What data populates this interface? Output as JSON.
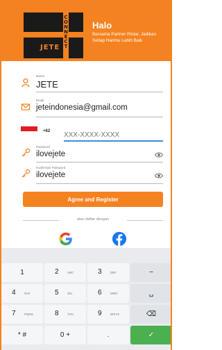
{
  "header": {
    "logo_word": "JETE",
    "logo_vertical": "CONNECT",
    "greeting_title": "Halo",
    "greeting_subtitle": "Bersama Partner Pintar, Jadikan Setiap Harimu Lebih Baik"
  },
  "form": {
    "name": {
      "label": "Name",
      "value": "JETE"
    },
    "email": {
      "label": "Email",
      "value": "jeteindonesia@gmail.com"
    },
    "phone": {
      "dial_code": "+62",
      "placeholder": "XXX-XXXX-XXXX"
    },
    "password": {
      "label": "Password",
      "value": "ilovejete"
    },
    "confirm_password": {
      "label": "Konfirmasi Password",
      "value": "ilovejete"
    },
    "register_label": "Agree and Register",
    "divider_text": "atau daftar dengan"
  },
  "social": [
    "google-icon",
    "facebook-icon"
  ],
  "keyboard": {
    "rows": [
      [
        {
          "main": "1",
          "sub": ""
        },
        {
          "main": "2",
          "sub": "ABC"
        },
        {
          "main": "3",
          "sub": "DEF"
        },
        {
          "main": "−",
          "sub": ""
        }
      ],
      [
        {
          "main": "4",
          "sub": "GHI"
        },
        {
          "main": "5",
          "sub": "JKL"
        },
        {
          "main": "6",
          "sub": "MNO"
        },
        {
          "main": "␣",
          "sub": ""
        }
      ],
      [
        {
          "main": "7",
          "sub": "PQRS"
        },
        {
          "main": "8",
          "sub": "TUV"
        },
        {
          "main": "9",
          "sub": "WXYZ"
        },
        {
          "main": "⌫",
          "sub": ""
        }
      ],
      [
        {
          "main": "* #",
          "sub": ""
        },
        {
          "main": "0 +",
          "sub": ""
        },
        {
          "main": ".",
          "sub": ""
        },
        {
          "main": "✓",
          "sub": ""
        }
      ]
    ]
  },
  "colors": {
    "brand": "#f58220",
    "focus": "#3b8fd6",
    "action_key": "#4caf50"
  }
}
